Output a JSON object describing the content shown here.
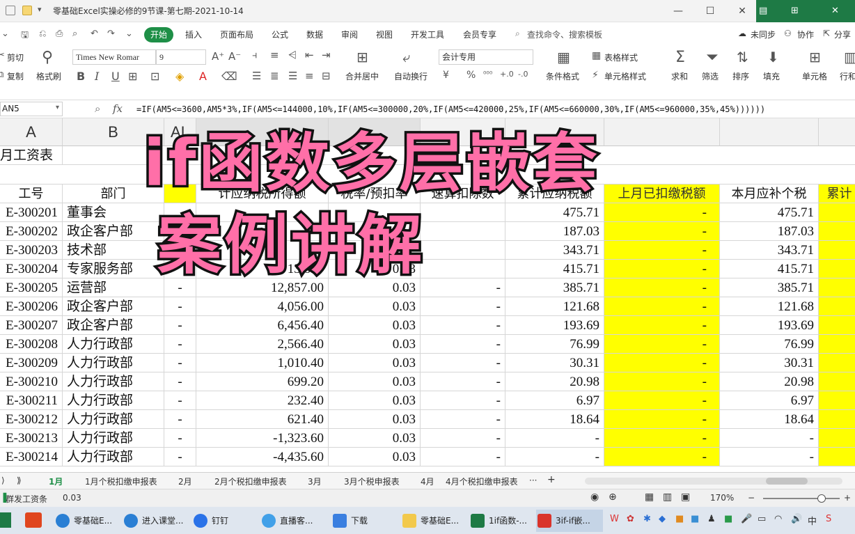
{
  "window": {
    "title": "零基础Excel实操必修的9节课-第七期-2021-10-14",
    "minimize": "—",
    "maximize": "☐",
    "close": "✕"
  },
  "menu": {
    "tabs": [
      "开始",
      "插入",
      "页面布局",
      "公式",
      "数据",
      "审阅",
      "视图",
      "开发工具",
      "会员专享"
    ],
    "search": "查找命令、搜索模板",
    "sync": "未同步",
    "collab": "协作",
    "share": "分享"
  },
  "ribbon": {
    "cut": "剪切",
    "copy": "复制",
    "format_painter": "格式刷",
    "font_name": "Times New Romar",
    "font_size": "9",
    "merge": "合并居中",
    "wrap": "自动换行",
    "number_format": "会计专用",
    "table_style": "表格样式",
    "cond_format": "条件格式",
    "cell_style": "单元格样式",
    "sum": "求和",
    "filter": "筛选",
    "sort": "排序",
    "fill": "填充",
    "cell": "单元格",
    "row_col": "行和"
  },
  "formula_bar": {
    "name_box": "AN5",
    "fx": "fx",
    "formula": "=IF(AM5<=3600,AM5*3%,IF(AM5<=144000,10%,IF(AM5<=300000,20%,IF(AM5<=420000,25%,IF(AM5<=660000,30%,IF(AM5<=960000,35%,45%))))))"
  },
  "columns": [
    "A",
    "B",
    "AL",
    "",
    "",
    "",
    "",
    "",
    ""
  ],
  "sheet_title": "月工资表",
  "headers": {
    "id": "工号",
    "dept": "部门",
    "taxable": "计应纳税所得额",
    "rate": "税率/预扣率",
    "deduction": "速算扣除数",
    "cum_tax": "累计应纳税额",
    "prev_tax": "上月已扣缴税额",
    "curr_tax": "本月应补个税",
    "cum_tax2": "累计"
  },
  "rows": [
    {
      "id": "E-300201",
      "dept": "董事会",
      "al": "",
      "taxable": "",
      "rate": "",
      "deduction": "",
      "cum": "475.71",
      "prev": "-",
      "curr": "475.71"
    },
    {
      "id": "E-300202",
      "dept": "政企客户部",
      "al": "",
      "taxable": "",
      "rate": "",
      "deduction": "",
      "cum": "187.03",
      "prev": "-",
      "curr": "187.03"
    },
    {
      "id": "E-300203",
      "dept": "技术部",
      "al": "",
      "taxable": "",
      "rate": "",
      "deduction": "",
      "cum": "343.71",
      "prev": "-",
      "curr": "343.71"
    },
    {
      "id": "E-300204",
      "dept": "专家服务部",
      "al": "",
      "taxable": "13,857",
      "rate": "0.03",
      "deduction": "",
      "cum": "415.71",
      "prev": "-",
      "curr": "415.71"
    },
    {
      "id": "E-300205",
      "dept": "运营部",
      "al": "-",
      "taxable": "12,857.00",
      "rate": "0.03",
      "deduction": "-",
      "cum": "385.71",
      "prev": "-",
      "curr": "385.71"
    },
    {
      "id": "E-300206",
      "dept": "政企客户部",
      "al": "-",
      "taxable": "4,056.00",
      "rate": "0.03",
      "deduction": "-",
      "cum": "121.68",
      "prev": "-",
      "curr": "121.68"
    },
    {
      "id": "E-300207",
      "dept": "政企客户部",
      "al": "-",
      "taxable": "6,456.40",
      "rate": "0.03",
      "deduction": "-",
      "cum": "193.69",
      "prev": "-",
      "curr": "193.69"
    },
    {
      "id": "E-300208",
      "dept": "人力行政部",
      "al": "-",
      "taxable": "2,566.40",
      "rate": "0.03",
      "deduction": "-",
      "cum": "76.99",
      "prev": "-",
      "curr": "76.99"
    },
    {
      "id": "E-300209",
      "dept": "人力行政部",
      "al": "-",
      "taxable": "1,010.40",
      "rate": "0.03",
      "deduction": "-",
      "cum": "30.31",
      "prev": "-",
      "curr": "30.31"
    },
    {
      "id": "E-300210",
      "dept": "人力行政部",
      "al": "-",
      "taxable": "699.20",
      "rate": "0.03",
      "deduction": "-",
      "cum": "20.98",
      "prev": "-",
      "curr": "20.98"
    },
    {
      "id": "E-300211",
      "dept": "人力行政部",
      "al": "-",
      "taxable": "232.40",
      "rate": "0.03",
      "deduction": "-",
      "cum": "6.97",
      "prev": "-",
      "curr": "6.97"
    },
    {
      "id": "E-300212",
      "dept": "人力行政部",
      "al": "-",
      "taxable": "621.40",
      "rate": "0.03",
      "deduction": "-",
      "cum": "18.64",
      "prev": "-",
      "curr": "18.64"
    },
    {
      "id": "E-300213",
      "dept": "人力行政部",
      "al": "-",
      "taxable": "-1,323.60",
      "rate": "0.03",
      "deduction": "-",
      "cum": "-",
      "prev": "-",
      "curr": "-"
    },
    {
      "id": "E-300214",
      "dept": "人力行政部",
      "al": "-",
      "taxable": "-4,435.60",
      "rate": "0.03",
      "deduction": "-",
      "cum": "-",
      "prev": "-",
      "curr": "-"
    }
  ],
  "overlay": {
    "line1": "if函数多层嵌套",
    "line2": "案例讲解"
  },
  "sheet_tabs": [
    "1月",
    "1月个税扣缴申报表",
    "2月",
    "2月个税扣缴申报表",
    "3月",
    "3月个税申报表",
    "4月",
    "4月个税扣缴申报表"
  ],
  "status": {
    "app": "群发工资条",
    "value": "0.03",
    "zoom": "170%"
  },
  "taskbar": {
    "items": [
      "零基础E...",
      "进入课堂...",
      "钉钉",
      "直播客...",
      "下载",
      "零基础E...",
      "1if函数-...",
      "3if-if嵌..."
    ],
    "ime": "中"
  },
  "colors": {
    "accent": "#1e8f47",
    "highlight": "#ffff00",
    "overlay_fill": "#ff6fa8"
  }
}
